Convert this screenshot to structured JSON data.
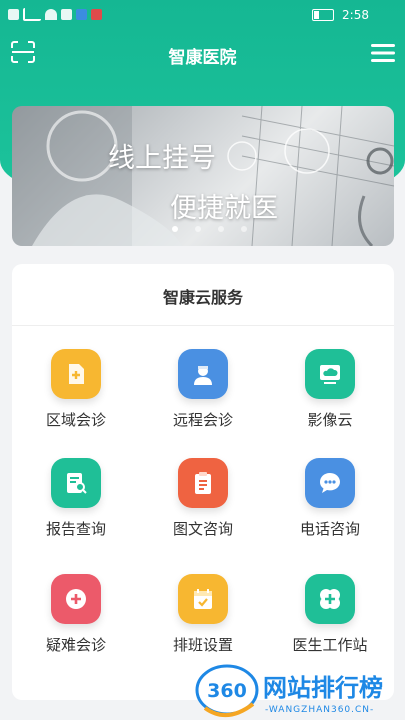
{
  "status_bar": {
    "time": "2:58"
  },
  "header": {
    "title": "智康医院"
  },
  "banner": {
    "line1": "线上挂号",
    "line2": "便捷就医",
    "slide_count": 4,
    "active_slide": 0
  },
  "services": {
    "title": "智康云服务",
    "items": [
      {
        "label": "区域会诊",
        "icon": "document-plus-icon",
        "color": "#f7b731"
      },
      {
        "label": "远程会诊",
        "icon": "nurse-icon",
        "color": "#4a90e2"
      },
      {
        "label": "影像云",
        "icon": "cloud-monitor-icon",
        "color": "#1fbf97"
      },
      {
        "label": "报告查询",
        "icon": "report-search-icon",
        "color": "#1fbf97"
      },
      {
        "label": "图文咨询",
        "icon": "clipboard-icon",
        "color": "#ef6341"
      },
      {
        "label": "电话咨询",
        "icon": "chat-bubble-icon",
        "color": "#4a90e2"
      },
      {
        "label": "疑难会诊",
        "icon": "plus-circle-icon",
        "color": "#ec5a6a"
      },
      {
        "label": "排班设置",
        "icon": "calendar-check-icon",
        "color": "#f7b731"
      },
      {
        "label": "医生工作站",
        "icon": "medical-cross-icon",
        "color": "#1fbf97"
      }
    ]
  },
  "watermark": {
    "brand": "网站排行榜",
    "domain": "WANGZHAN360.CN",
    "number": "360"
  }
}
